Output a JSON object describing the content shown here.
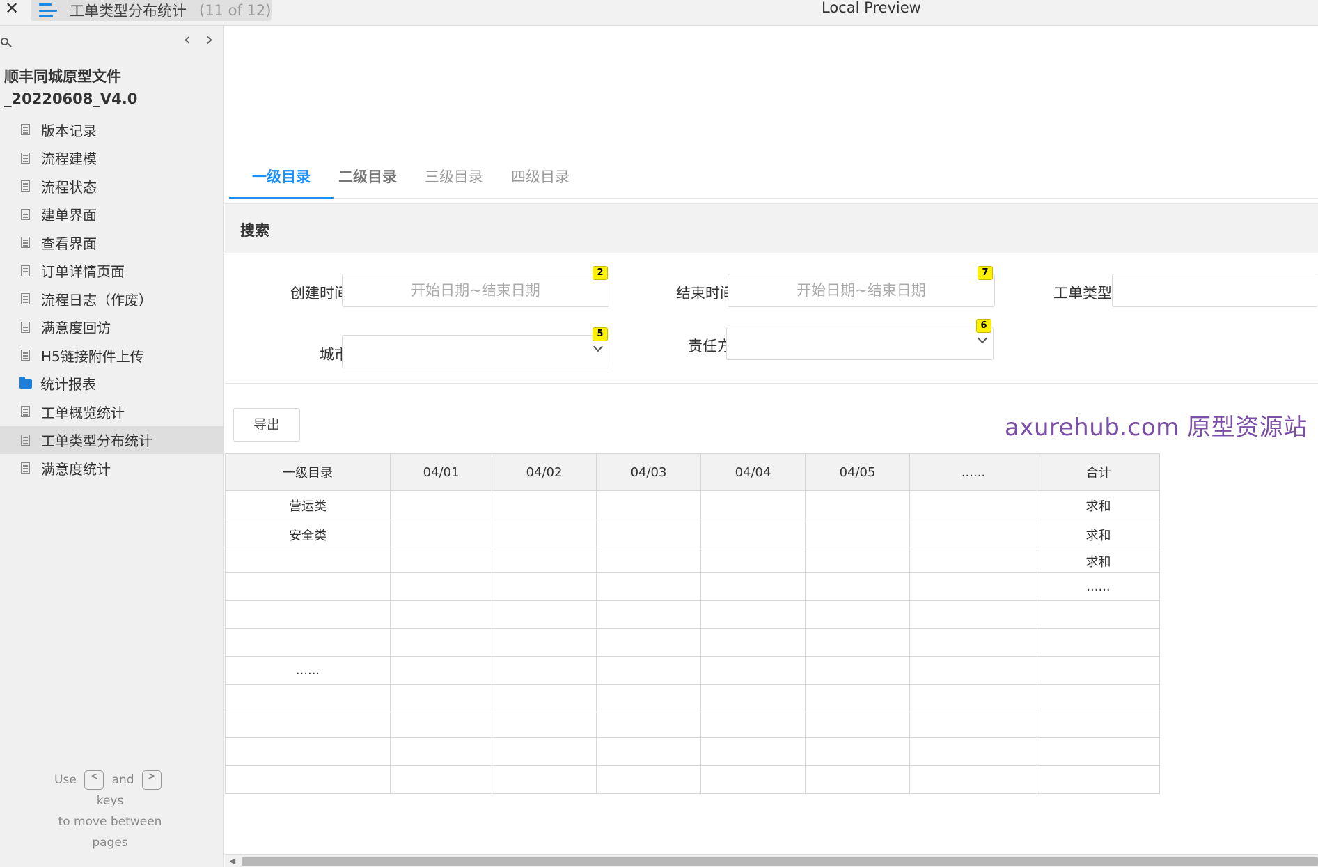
{
  "topbar": {
    "close_glyph": "✕",
    "page_title": "工单类型分布统计",
    "page_count": "(11 of 12)",
    "preview_title": "Local Preview"
  },
  "sidebar": {
    "prev_glyph": "‹",
    "next_glyph": "›",
    "project_name_line1": "顺丰同城原型文件",
    "project_name_line2": "_20220608_V4.0",
    "items": [
      {
        "label": "版本记录",
        "icon": "page-icon"
      },
      {
        "label": "流程建模",
        "icon": "page-icon"
      },
      {
        "label": "流程状态",
        "icon": "page-icon"
      },
      {
        "label": "建单界面",
        "icon": "page-icon"
      },
      {
        "label": "查看界面",
        "icon": "page-icon"
      },
      {
        "label": "订单详情页面",
        "icon": "page-icon"
      },
      {
        "label": "流程日志（作废）",
        "icon": "page-icon"
      },
      {
        "label": "满意度回访",
        "icon": "page-icon"
      },
      {
        "label": "H5链接附件上传",
        "icon": "page-icon"
      },
      {
        "label": "统计报表",
        "icon": "folder-icon"
      },
      {
        "label": "工单概览统计",
        "icon": "page-icon"
      },
      {
        "label": "工单类型分布统计",
        "icon": "page-icon",
        "active": true
      },
      {
        "label": "满意度统计",
        "icon": "page-icon"
      }
    ],
    "help": {
      "use": "Use",
      "prev_key": "<",
      "and": "and",
      "next_key": ">",
      "keys": "keys",
      "line3": "to move between",
      "line4": "pages"
    }
  },
  "main": {
    "tabs": [
      "一级目录",
      "二级目录",
      "三级目录",
      "四级目录"
    ],
    "search_title": "搜索",
    "form": {
      "created_label": "创建时间",
      "created_placeholder": "开始日期~结束日期",
      "created_badge": "2",
      "ended_label": "结束时间",
      "ended_placeholder": "开始日期~结束日期",
      "ended_badge": "7",
      "type_label": "工单类型",
      "city_label": "城市",
      "city_badge": "5",
      "owner_label": "责任方",
      "owner_badge": "6"
    },
    "export_label": "导出",
    "watermark": "axurehub.com 原型资源站",
    "table": {
      "headers": [
        "一级目录",
        "04/01",
        "04/02",
        "04/03",
        "04/04",
        "04/05",
        "......",
        "合计"
      ],
      "rows": [
        [
          "营运类",
          "",
          "",
          "",
          "",
          "",
          "",
          "求和"
        ],
        [
          "安全类",
          "",
          "",
          "",
          "",
          "",
          "",
          "求和"
        ],
        [
          "",
          "",
          "",
          "",
          "",
          "",
          "",
          "求和"
        ],
        [
          "",
          "",
          "",
          "",
          "",
          "",
          "",
          "......"
        ],
        [
          "",
          "",
          "",
          "",
          "",
          "",
          "",
          ""
        ],
        [
          "",
          "",
          "",
          "",
          "",
          "",
          "",
          ""
        ],
        [
          "......",
          "",
          "",
          "",
          "",
          "",
          "",
          ""
        ],
        [
          "",
          "",
          "",
          "",
          "",
          "",
          "",
          ""
        ],
        [
          "",
          "",
          "",
          "",
          "",
          "",
          "",
          ""
        ],
        [
          "",
          "",
          "",
          "",
          "",
          "",
          "",
          ""
        ],
        [
          "",
          "",
          "",
          "",
          "",
          "",
          "",
          ""
        ]
      ]
    }
  }
}
